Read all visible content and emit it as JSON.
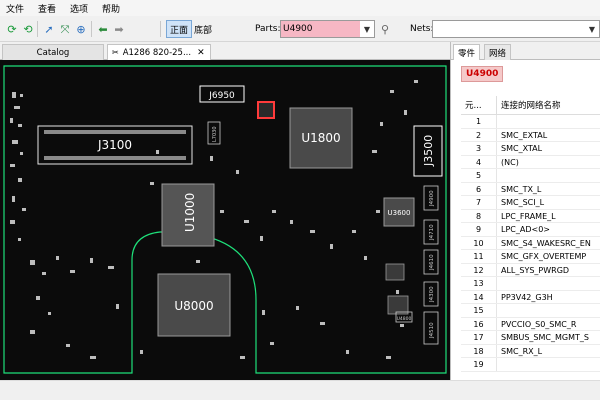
{
  "menu": [
    "文件",
    "查看",
    "选项",
    "帮助"
  ],
  "toolbar": {
    "view_top_label": "正面",
    "view_bottom_label": "底部",
    "parts_label": "Parts:",
    "parts_value": "U4900",
    "nets_label": "Nets:",
    "nets_value": ""
  },
  "tabs": {
    "catalog": "Catalog",
    "board": "A1286 820-25...",
    "board_close": "✕"
  },
  "right_tabs": [
    "零件",
    "网络"
  ],
  "selected_part": "U4900",
  "net_table": {
    "col_pin": "元...",
    "col_net": "连接的网络名称",
    "rows": [
      {
        "n": "1",
        "name": ""
      },
      {
        "n": "2",
        "name": "SMC_EXTAL"
      },
      {
        "n": "3",
        "name": "SMC_XTAL"
      },
      {
        "n": "4",
        "name": "(NC)"
      },
      {
        "n": "5",
        "name": ""
      },
      {
        "n": "6",
        "name": "SMC_TX_L"
      },
      {
        "n": "7",
        "name": "SMC_SCI_L"
      },
      {
        "n": "8",
        "name": "LPC_FRAME_L"
      },
      {
        "n": "9",
        "name": "LPC_AD<0>"
      },
      {
        "n": "10",
        "name": "SMC_S4_WAKESRC_EN"
      },
      {
        "n": "11",
        "name": "SMC_GFX_OVERTEMP"
      },
      {
        "n": "12",
        "name": "ALL_SYS_PWRGD"
      },
      {
        "n": "13",
        "name": ""
      },
      {
        "n": "14",
        "name": "PP3V42_G3H"
      },
      {
        "n": "15",
        "name": ""
      },
      {
        "n": "16",
        "name": "PVCCIO_S0_SMC_R"
      },
      {
        "n": "17",
        "name": "SMBUS_SMC_MGMT_S"
      },
      {
        "n": "18",
        "name": "SMC_RX_L"
      },
      {
        "n": "19",
        "name": ""
      }
    ]
  },
  "board_labels": {
    "j6950": "J6950",
    "j3100": "J3100",
    "u1800": "U1800",
    "j3500": "J3500",
    "u1000": "U1000",
    "u3600": "U3600",
    "u8000": "U8000",
    "l7030": "L7030",
    "j4900": "J4900",
    "j4710": "J4710",
    "j4610": "J4610",
    "j4300": "J4300",
    "u4800": "U4800",
    "j4510": "J4510"
  },
  "colors": {
    "board_bg": "#0b0b0b",
    "trace": "#1ee07a",
    "part_highlight": "#ff3b3b",
    "part_chip_bg": "#f5c9c9",
    "parts_field_bg": "#f6b7c4"
  },
  "icons": [
    "refresh-icon",
    "refresh-alt-icon",
    "cursor-icon",
    "zoom-fit-icon",
    "zoom-in-icon",
    "zoom-out-icon",
    "back-icon",
    "forward-icon",
    "search-icon",
    "chevron-down-icon",
    "close-icon",
    "pin-icon"
  ]
}
